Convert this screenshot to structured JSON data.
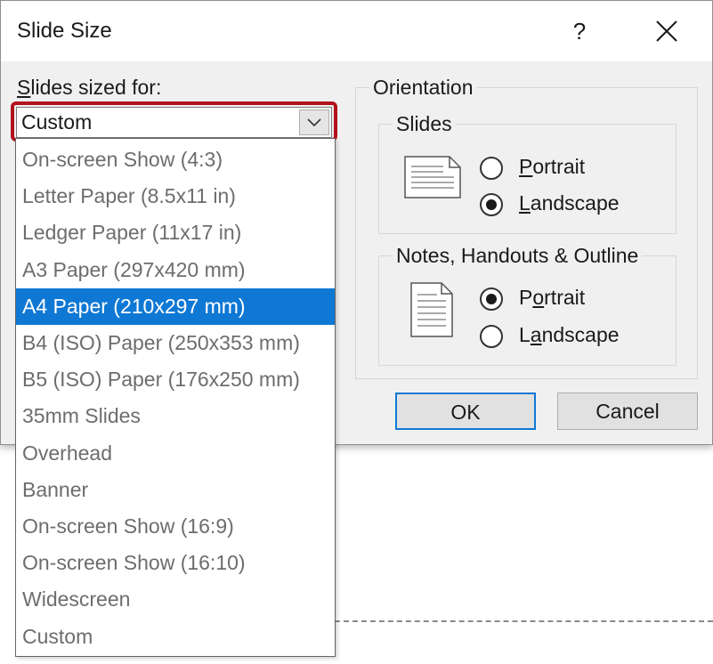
{
  "dialog": {
    "title": "Slide Size",
    "help_label": "?",
    "ok_label": "OK",
    "cancel_label": "Cancel"
  },
  "slides_sized_for": {
    "label_mnemonic": "S",
    "label_rest": "lides sized for:",
    "value": "Custom",
    "highlight_color": "#b2121d",
    "options": [
      "On-screen Show (4:3)",
      "Letter Paper (8.5x11 in)",
      "Ledger Paper (11x17 in)",
      "A3 Paper (297x420 mm)",
      "A4 Paper (210x297 mm)",
      "B4 (ISO) Paper (250x353 mm)",
      "B5 (ISO) Paper (176x250 mm)",
      "35mm Slides",
      "Overhead",
      "Banner",
      "On-screen Show (16:9)",
      "On-screen Show (16:10)",
      "Widescreen",
      "Custom"
    ],
    "selected_option": "A4 Paper (210x297 mm)",
    "selected_color": "#0f78d4"
  },
  "orientation": {
    "title": "Orientation",
    "slides": {
      "title": "Slides",
      "portrait_mnemonic": "P",
      "portrait_rest": "ortrait",
      "landscape_mnemonic": "L",
      "landscape_rest": "andscape",
      "selected": "landscape",
      "icon": "landscape-page-icon"
    },
    "notes": {
      "title": "Notes, Handouts & Outline",
      "portrait_pre": "P",
      "portrait_mnemonic": "o",
      "portrait_rest": "rtrait",
      "landscape_pre": "L",
      "landscape_mnemonic": "a",
      "landscape_rest": "ndscape",
      "selected": "portrait",
      "icon": "portrait-page-icon"
    }
  }
}
